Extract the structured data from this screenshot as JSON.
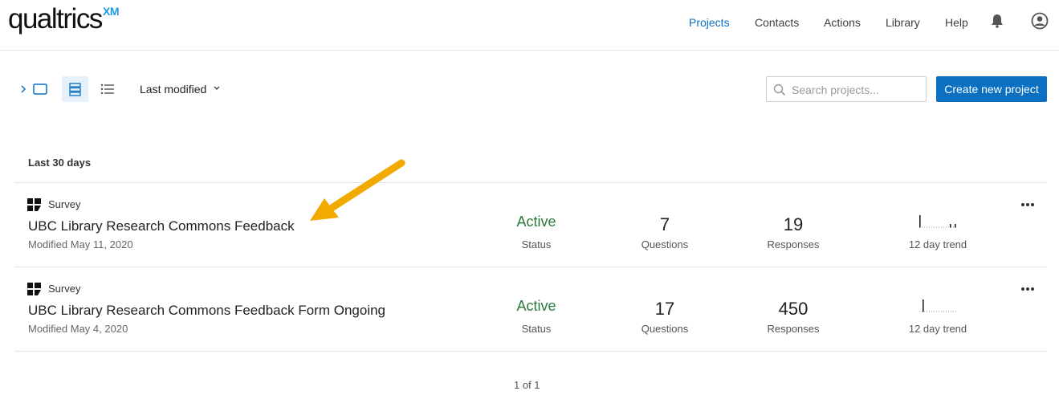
{
  "logo": {
    "text": "qualtrics",
    "suffix": "XM"
  },
  "nav": {
    "items": [
      "Projects",
      "Contacts",
      "Actions",
      "Library",
      "Help"
    ],
    "active": "Projects"
  },
  "toolbar": {
    "sort_label": "Last modified",
    "search_placeholder": "Search projects...",
    "create_label": "Create new project"
  },
  "section": {
    "label": "Last 30 days"
  },
  "projects": [
    {
      "type": "Survey",
      "title": "UBC Library Research Commons Feedback",
      "modified": "Modified May 11, 2020",
      "status": "Active",
      "status_label": "Status",
      "questions": "7",
      "questions_label": "Questions",
      "responses": "19",
      "responses_label": "Responses",
      "trend_label": "12 day trend"
    },
    {
      "type": "Survey",
      "title": "UBC Library Research Commons Feedback Form Ongoing",
      "modified": "Modified May 4, 2020",
      "status": "Active",
      "status_label": "Status",
      "questions": "17",
      "questions_label": "Questions",
      "responses": "450",
      "responses_label": "Responses",
      "trend_label": "12 day trend"
    }
  ],
  "pager": {
    "text": "1 of 1"
  },
  "colors": {
    "brand_blue": "#0b6fc2",
    "active_green": "#2b7a3c",
    "annotation_arrow": "#f2a900"
  }
}
